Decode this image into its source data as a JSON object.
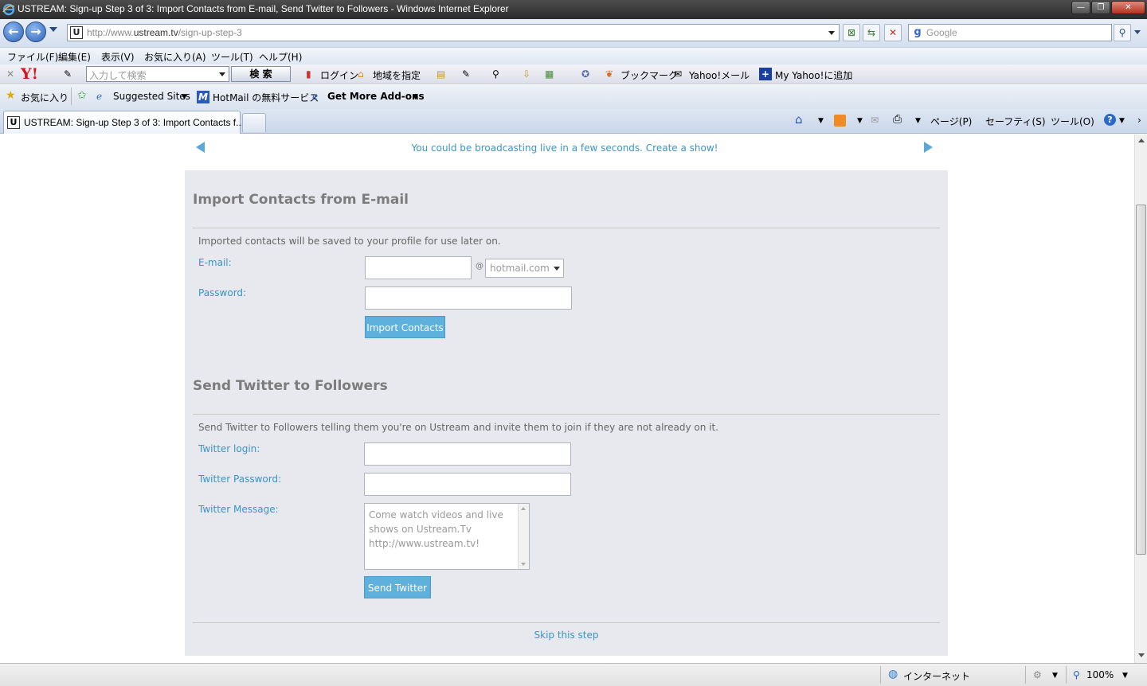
{
  "window": {
    "title": "USTREAM: Sign-up Step 3 of 3: Import Contacts from E-mail, Send Twitter to Followers - Windows Internet Explorer",
    "minimize": "—",
    "maximize": "❐",
    "close": "✕"
  },
  "address": {
    "url_prefix": "http://www.",
    "url_domain": "ustream.tv",
    "url_path": "/sign-up-step-3",
    "favicon": "U"
  },
  "search": {
    "placeholder": "Google",
    "logo": "g"
  },
  "menu": [
    "ファイル(F)",
    "編集(E)",
    "表示(V)",
    "お気に入り(A)",
    "ツール(T)",
    "ヘルプ(H)"
  ],
  "yahoo_toolbar": {
    "logo": "Y!",
    "search_placeholder": "入力して検索",
    "search_button": "検 索",
    "login": "ログイン",
    "region": "地域を指定",
    "bookmarks": "ブックマーク",
    "mail": "Yahoo!メール",
    "add": "My Yahoo!に追加"
  },
  "favorites_bar": {
    "favorites": "お気に入り",
    "suggested": "Suggested Sites",
    "hotmail": "HotMail の無料サービス",
    "addons": "Get More Add-ons"
  },
  "tab": {
    "title": "USTREAM: Sign-up Step 3 of 3: Import Contacts f...",
    "favicon": "U"
  },
  "command_bar": {
    "page": "ページ(P)",
    "safety": "セーフティ(S)",
    "tools": "ツール(O)"
  },
  "page": {
    "promo": "You could be broadcasting live in a few seconds. Create a show!",
    "import": {
      "heading": "Import Contacts from E-mail",
      "description": "Imported contacts will be saved to your profile for use later on.",
      "email_label": "E-mail:",
      "at": "@",
      "domain_selected": "hotmail.com",
      "password_label": "Password:",
      "button": "Import Contacts"
    },
    "twitter": {
      "heading": "Send Twitter to Followers",
      "description": "Send Twitter to Followers telling them you're on Ustream and invite them to join if they are not already on it.",
      "login_label": "Twitter login:",
      "password_label": "Twitter Password:",
      "message_label": "Twitter Message:",
      "message_line1": "Come watch videos and live",
      "message_line2": "shows on Ustream.Tv",
      "message_line3": "http://www.ustream.tv!",
      "button": "Send Twitter"
    },
    "skip": "Skip this step"
  },
  "status": {
    "zone": "インターネット",
    "zoom": "100%"
  },
  "colors": {
    "accent": "#3a94c6",
    "button": "#5fb1dd",
    "panel": "#e8e9ee"
  }
}
